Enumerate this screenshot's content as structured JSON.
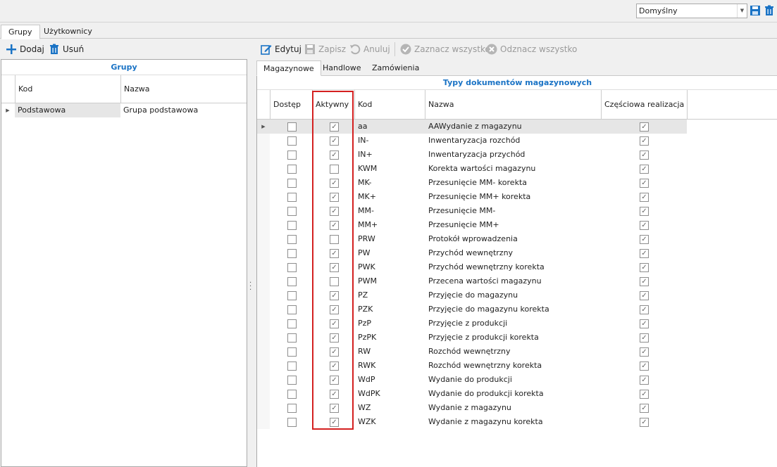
{
  "layout_select": {
    "value": "Domyślny"
  },
  "main_tabs": [
    "Grupy",
    "Użytkownicy"
  ],
  "left_toolbar": {
    "add_label": "Dodaj",
    "delete_label": "Usuń"
  },
  "right_toolbar": {
    "edit_label": "Edytuj",
    "save_label": "Zapisz",
    "cancel_label": "Anuluj",
    "select_all_label": "Zaznacz wszystko",
    "deselect_all_label": "Odznacz wszystko"
  },
  "groups_grid": {
    "title": "Grupy",
    "columns": [
      "Kod",
      "Nazwa"
    ],
    "rows": [
      {
        "kod": "Podstawowa",
        "nazwa": "Grupa podstawowa"
      }
    ]
  },
  "sub_tabs": [
    "Magazynowe",
    "Handlowe",
    "Zamówienia"
  ],
  "docs_grid": {
    "title": "Typy dokumentów magazynowych",
    "columns": [
      "Dostęp",
      "Aktywny",
      "Kod",
      "Nazwa",
      "Częściowa realizacja"
    ],
    "rows": [
      {
        "dostep": false,
        "aktywny": true,
        "kod": "aa",
        "nazwa": "AAWydanie z magazynu",
        "czesciowa": true
      },
      {
        "dostep": false,
        "aktywny": true,
        "kod": "IN-",
        "nazwa": "Inwentaryzacja rozchód",
        "czesciowa": true
      },
      {
        "dostep": false,
        "aktywny": true,
        "kod": "IN+",
        "nazwa": "Inwentaryzacja przychód",
        "czesciowa": true
      },
      {
        "dostep": false,
        "aktywny": false,
        "kod": "KWM",
        "nazwa": "Korekta wartości magazynu",
        "czesciowa": true
      },
      {
        "dostep": false,
        "aktywny": true,
        "kod": "MK-",
        "nazwa": "Przesunięcie MM- korekta",
        "czesciowa": true
      },
      {
        "dostep": false,
        "aktywny": true,
        "kod": "MK+",
        "nazwa": "Przesunięcie MM+ korekta",
        "czesciowa": true
      },
      {
        "dostep": false,
        "aktywny": true,
        "kod": "MM-",
        "nazwa": "Przesunięcie MM-",
        "czesciowa": true
      },
      {
        "dostep": false,
        "aktywny": true,
        "kod": "MM+",
        "nazwa": "Przesunięcie MM+",
        "czesciowa": true
      },
      {
        "dostep": false,
        "aktywny": false,
        "kod": "PRW",
        "nazwa": "Protokół wprowadzenia",
        "czesciowa": true
      },
      {
        "dostep": false,
        "aktywny": true,
        "kod": "PW",
        "nazwa": "Przychód wewnętrzny",
        "czesciowa": true
      },
      {
        "dostep": false,
        "aktywny": true,
        "kod": "PWK",
        "nazwa": "Przychód wewnętrzny korekta",
        "czesciowa": true
      },
      {
        "dostep": false,
        "aktywny": false,
        "kod": "PWM",
        "nazwa": "Przecena wartości magazynu",
        "czesciowa": true
      },
      {
        "dostep": false,
        "aktywny": true,
        "kod": "PZ",
        "nazwa": "Przyjęcie do magazynu",
        "czesciowa": true
      },
      {
        "dostep": false,
        "aktywny": true,
        "kod": "PZK",
        "nazwa": "Przyjęcie do magazynu korekta",
        "czesciowa": true
      },
      {
        "dostep": false,
        "aktywny": true,
        "kod": "PzP",
        "nazwa": "Przyjęcie z produkcji",
        "czesciowa": true
      },
      {
        "dostep": false,
        "aktywny": true,
        "kod": "PzPK",
        "nazwa": "Przyjęcie z produkcji korekta",
        "czesciowa": true
      },
      {
        "dostep": false,
        "aktywny": true,
        "kod": "RW",
        "nazwa": "Rozchód wewnętrzny",
        "czesciowa": true
      },
      {
        "dostep": false,
        "aktywny": true,
        "kod": "RWK",
        "nazwa": "Rozchód wewnętrzny korekta",
        "czesciowa": true
      },
      {
        "dostep": false,
        "aktywny": true,
        "kod": "WdP",
        "nazwa": "Wydanie do produkcji",
        "czesciowa": true
      },
      {
        "dostep": false,
        "aktywny": true,
        "kod": "WdPK",
        "nazwa": "Wydanie do produkcji korekta",
        "czesciowa": true
      },
      {
        "dostep": false,
        "aktywny": true,
        "kod": "WZ",
        "nazwa": "Wydanie z magazynu",
        "czesciowa": true
      },
      {
        "dostep": false,
        "aktywny": true,
        "kod": "WZK",
        "nazwa": "Wydanie z magazynu korekta",
        "czesciowa": true
      }
    ]
  },
  "colors": {
    "accent": "#1a73c5",
    "highlight": "#d42020"
  }
}
